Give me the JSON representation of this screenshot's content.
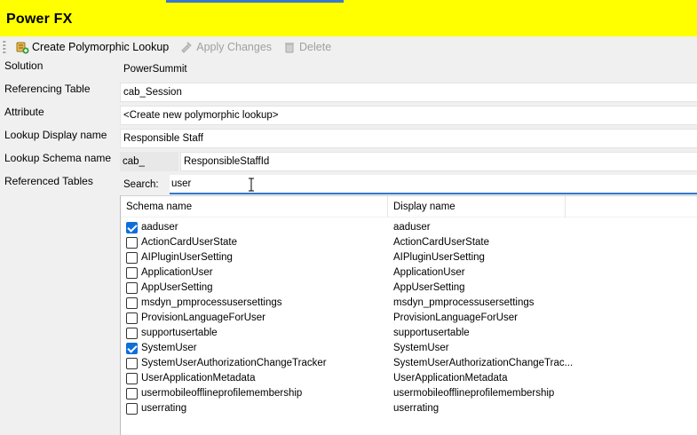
{
  "window": {
    "title": "Power FX"
  },
  "toolbar": {
    "create_label": "Create Polymorphic Lookup",
    "apply_label": "Apply Changes",
    "delete_label": "Delete"
  },
  "form": {
    "solution": {
      "label": "Solution",
      "value": "PowerSummit"
    },
    "referencing_table": {
      "label": "Referencing Table",
      "value": "cab_Session"
    },
    "attribute": {
      "label": "Attribute",
      "value": "<Create new polymorphic lookup>"
    },
    "lookup_display_name": {
      "label": "Lookup Display name",
      "value": "Responsible Staff"
    },
    "lookup_schema_name": {
      "label": "Lookup Schema name",
      "prefix": "cab_",
      "value": "ResponsibleStaffId"
    },
    "referenced_tables": {
      "label": "Referenced Tables"
    }
  },
  "search": {
    "label": "Search:",
    "value": "user"
  },
  "table": {
    "columns": [
      "Schema name",
      "Display name"
    ],
    "rows": [
      {
        "schema": "aaduser",
        "display": "aaduser",
        "checked": true
      },
      {
        "schema": "ActionCardUserState",
        "display": "ActionCardUserState",
        "checked": false
      },
      {
        "schema": "AIPluginUserSetting",
        "display": "AIPluginUserSetting",
        "checked": false
      },
      {
        "schema": "ApplicationUser",
        "display": "ApplicationUser",
        "checked": false
      },
      {
        "schema": "AppUserSetting",
        "display": "AppUserSetting",
        "checked": false
      },
      {
        "schema": "msdyn_pmprocessusersettings",
        "display": "msdyn_pmprocessusersettings",
        "checked": false
      },
      {
        "schema": "ProvisionLanguageForUser",
        "display": "ProvisionLanguageForUser",
        "checked": false
      },
      {
        "schema": "supportusertable",
        "display": "supportusertable",
        "checked": false
      },
      {
        "schema": "SystemUser",
        "display": "SystemUser",
        "checked": true
      },
      {
        "schema": "SystemUserAuthorizationChangeTracker",
        "display": "SystemUserAuthorizationChangeTrac...",
        "checked": false
      },
      {
        "schema": "UserApplicationMetadata",
        "display": "UserApplicationMetadata",
        "checked": false
      },
      {
        "schema": "usermobileofflineprofilemembership",
        "display": "usermobileofflineprofilemembership",
        "checked": false
      },
      {
        "schema": "userrating",
        "display": "userrating",
        "checked": false
      }
    ]
  }
}
